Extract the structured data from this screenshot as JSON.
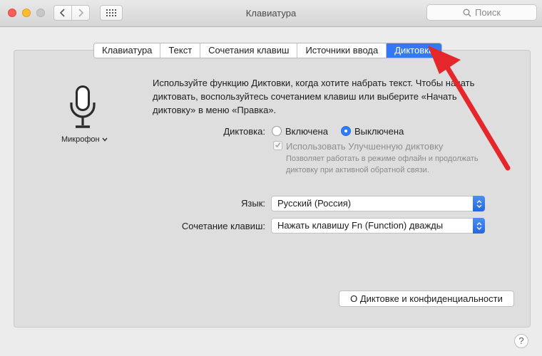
{
  "window": {
    "title": "Клавиатура"
  },
  "search": {
    "placeholder": "Поиск"
  },
  "tabs": [
    {
      "label": "Клавиатура",
      "active": false
    },
    {
      "label": "Текст",
      "active": false
    },
    {
      "label": "Сочетания клавиш",
      "active": false
    },
    {
      "label": "Источники ввода",
      "active": false
    },
    {
      "label": "Диктовка",
      "active": true
    }
  ],
  "mic": {
    "label": "Микрофон",
    "icon": "microphone-icon"
  },
  "intro": {
    "text": "Используйте функцию Диктовки, когда хотите набрать текст. Чтобы начать диктовать, воспользуйтесь сочетанием клавиш или выберите «Начать диктовку» в меню «Правка»."
  },
  "dictation": {
    "label": "Диктовка:",
    "options": [
      {
        "label": "Включена",
        "selected": false
      },
      {
        "label": "Выключена",
        "selected": true
      }
    ],
    "enhanced": {
      "label": "Использовать Улучшенную диктовку",
      "checked": true,
      "disabled": true,
      "desc_line1": "Позволяет работать в режиме офлайн и продолжать",
      "desc_line2": "диктовку при активной обратной связи."
    }
  },
  "language": {
    "label": "Язык:",
    "value": "Русский (Россия)"
  },
  "shortcut": {
    "label": "Сочетание клавиш:",
    "value": "Нажать клавишу Fn (Function) дважды"
  },
  "about_button": {
    "label": "О Диктовке и конфиденциальности"
  },
  "help_button": {
    "label": "?"
  },
  "colors": {
    "accent": "#3478f6",
    "annotation_arrow": "#e5262b"
  }
}
